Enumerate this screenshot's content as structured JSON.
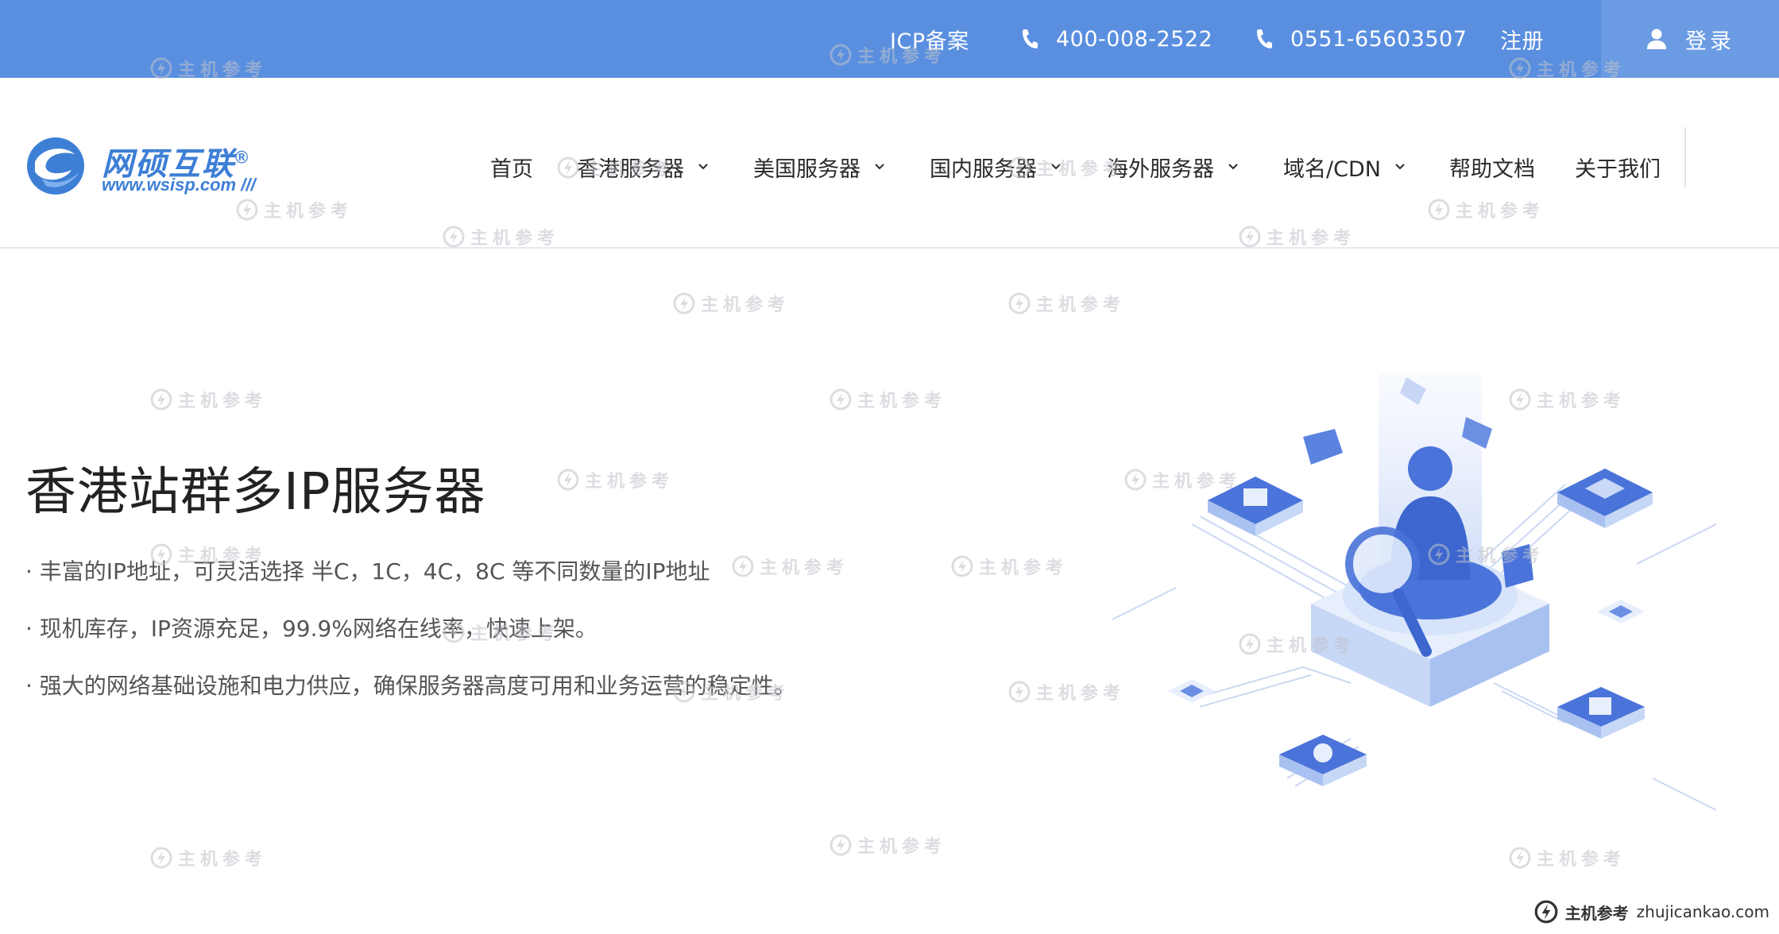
{
  "topbar": {
    "icp": "ICP备案",
    "phone1": "400-008-2522",
    "phone2": "0551-65603507",
    "register": "注册",
    "login": "登录"
  },
  "logo": {
    "name": "网硕互联",
    "registered": "®",
    "url": "www.wsisp.com"
  },
  "nav": {
    "items": [
      {
        "label": "首页",
        "dropdown": false
      },
      {
        "label": "香港服务器",
        "dropdown": true
      },
      {
        "label": "美国服务器",
        "dropdown": true
      },
      {
        "label": "国内服务器",
        "dropdown": true
      },
      {
        "label": "海外服务器",
        "dropdown": true
      },
      {
        "label": "域名/CDN",
        "dropdown": true
      },
      {
        "label": "帮助文档",
        "dropdown": false
      },
      {
        "label": "关于我们",
        "dropdown": false
      }
    ]
  },
  "hero": {
    "title": "香港站群多IP服务器",
    "bullets": [
      "· 丰富的IP地址，可灵活选择 半C，1C，4C，8C 等不同数量的IP地址",
      "· 现机库存，IP资源充足，99.9%网络在线率，快速上架。",
      "· 强大的网络基础设施和电力供应，确保服务器高度可用和业务运营的稳定性。"
    ]
  },
  "watermark": {
    "text": "主机参考",
    "sub": "ZHUJICANKAO.COM",
    "corner_name": "主机参考",
    "corner_domain": "zhujicankao.com"
  },
  "colors": {
    "topbar": "#5a8fe0",
    "login_bg": "#6b9be3",
    "brand": "#3e7fd6",
    "illustration_blue": "#4a74d9"
  },
  "icons": {
    "phone": "phone-icon",
    "user": "user-icon",
    "chevron": "chevron-down-icon"
  }
}
